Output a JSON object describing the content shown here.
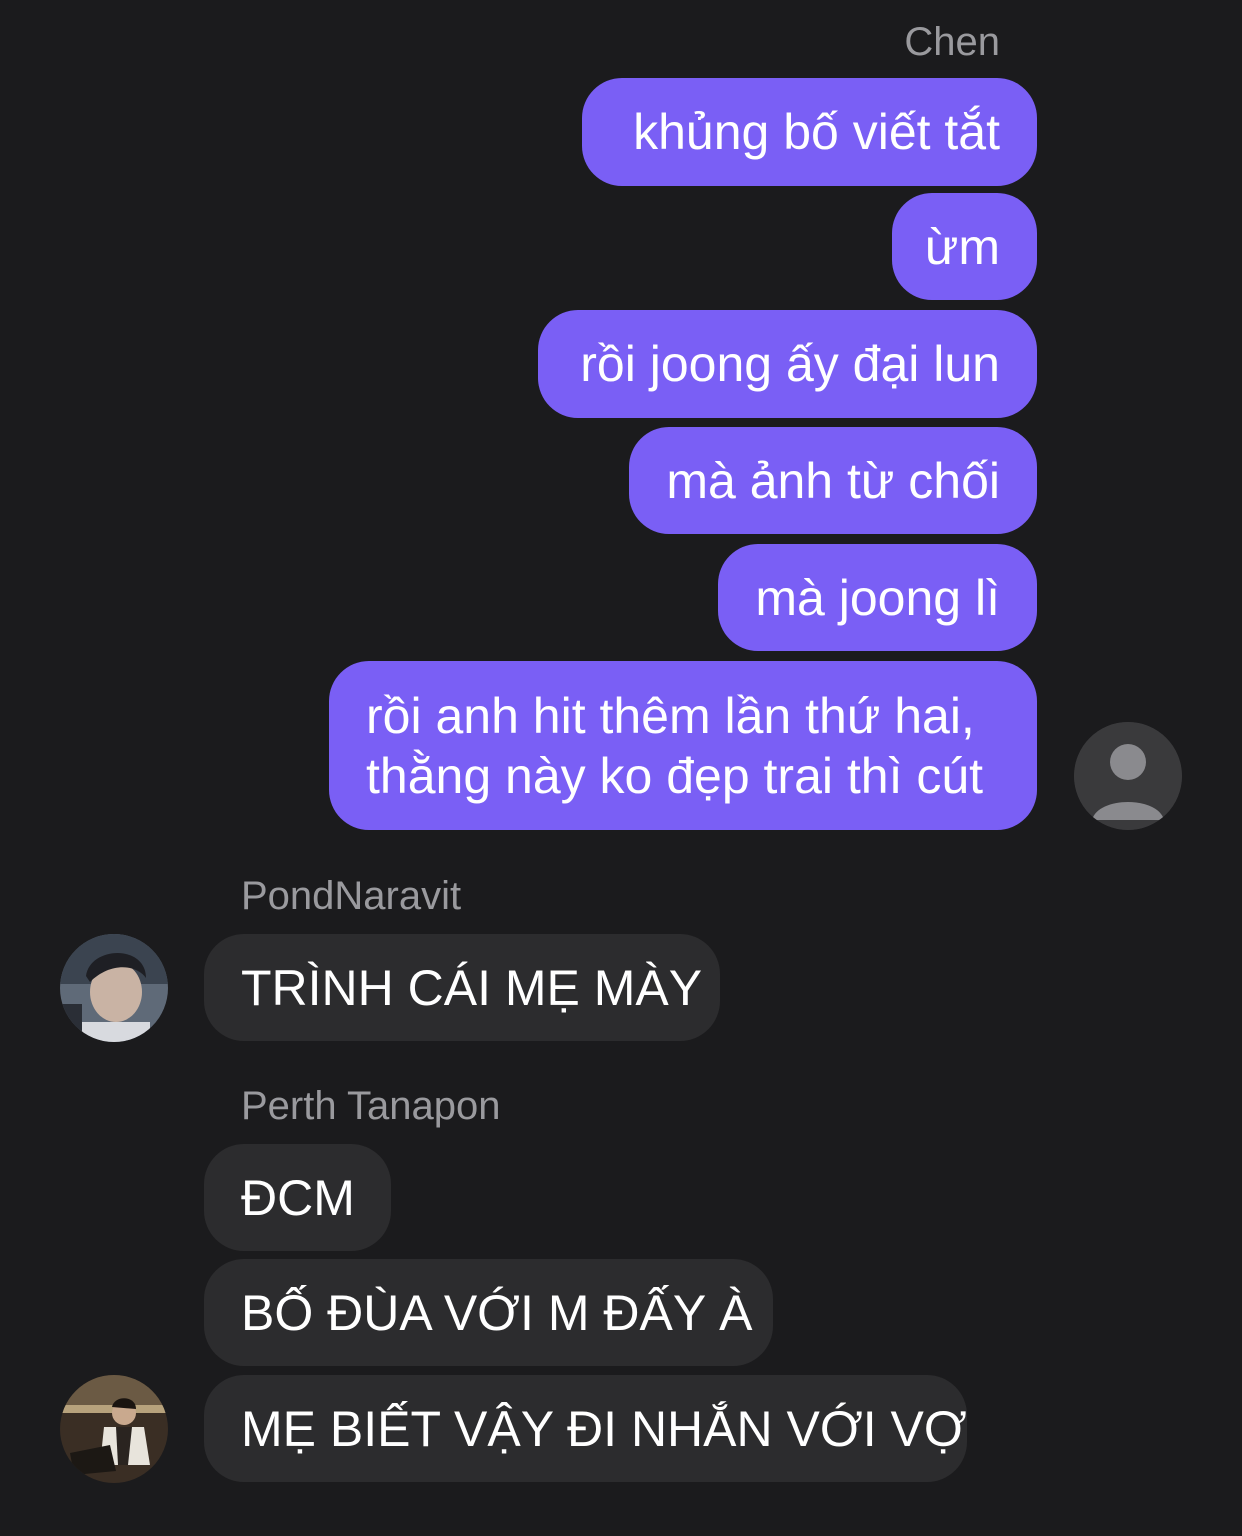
{
  "conversation": {
    "outgoing": {
      "sender": "Chen",
      "messages": [
        "khủng bố viết tắt",
        "ừm",
        "rồi joong ấy đại lun",
        "mà ảnh từ chối",
        "mà joong lì",
        "rồi anh hit thêm lần thứ hai, thằng này ko đẹp trai thì cút"
      ],
      "avatar_icon": "default-user-icon"
    },
    "incoming_1": {
      "sender": "PondNaravit",
      "messages": [
        "TRÌNH CÁI MẸ MÀY"
      ]
    },
    "incoming_2": {
      "sender": "Perth Tanapon",
      "messages": [
        "ĐCM",
        "BỐ ĐÙA VỚI M ĐẤY À",
        "MẸ BIẾT VẬY ĐI NHẮN VỚI VỢ"
      ]
    }
  },
  "colors": {
    "background": "#1b1b1d",
    "outgoing_bubble": "#7a5ff5",
    "incoming_bubble": "#2c2c2e",
    "sender_name": "#9a9a9e"
  }
}
